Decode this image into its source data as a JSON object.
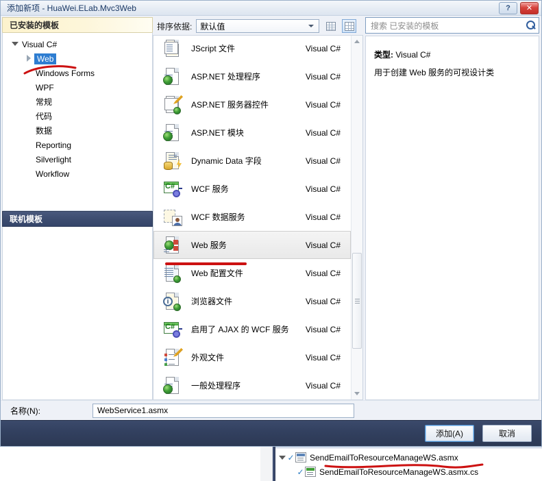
{
  "window": {
    "title": "添加新项 - HuaWei.ELab.Mvc3Web",
    "help_label": "?",
    "close_label": "✕"
  },
  "left": {
    "installed_header": "已安装的模板",
    "online_header": "联机模板",
    "tree": [
      {
        "label": "Visual C#",
        "level": 0,
        "twisty": "open",
        "selected": false
      },
      {
        "label": "Web",
        "level": 1,
        "twisty": "closed",
        "selected": true
      },
      {
        "label": "Windows Forms",
        "level": 1,
        "twisty": "none",
        "selected": false
      },
      {
        "label": "WPF",
        "level": 1,
        "twisty": "none",
        "selected": false
      },
      {
        "label": "常规",
        "level": 1,
        "twisty": "none",
        "selected": false
      },
      {
        "label": "代码",
        "level": 1,
        "twisty": "none",
        "selected": false
      },
      {
        "label": "数据",
        "level": 1,
        "twisty": "none",
        "selected": false
      },
      {
        "label": "Reporting",
        "level": 1,
        "twisty": "none",
        "selected": false
      },
      {
        "label": "Silverlight",
        "level": 1,
        "twisty": "none",
        "selected": false
      },
      {
        "label": "Workflow",
        "level": 1,
        "twisty": "none",
        "selected": false
      }
    ]
  },
  "toolbar": {
    "sort_label": "排序依据:",
    "sort_value": "默认值",
    "view_small_title": "小图标视图",
    "view_medium_title": "中等图标视图"
  },
  "search": {
    "placeholder": "搜索 已安装的模板"
  },
  "details": {
    "type_label": "类型:",
    "type_value": "Visual C#",
    "description": "用于创建 Web 服务的可视设计类"
  },
  "templates": [
    {
      "name": "JScript 文件",
      "lang": "Visual C#",
      "icon": "jscript-file-icon",
      "selected": false
    },
    {
      "name": "ASP.NET 处理程序",
      "lang": "Visual C#",
      "icon": "aspnet-handler-icon",
      "selected": false
    },
    {
      "name": "ASP.NET 服务器控件",
      "lang": "Visual C#",
      "icon": "aspnet-server-control-icon",
      "selected": false
    },
    {
      "name": "ASP.NET 模块",
      "lang": "Visual C#",
      "icon": "aspnet-module-icon",
      "selected": false
    },
    {
      "name": "Dynamic Data 字段",
      "lang": "Visual C#",
      "icon": "dynamic-data-field-icon",
      "selected": false
    },
    {
      "name": "WCF 服务",
      "lang": "Visual C#",
      "icon": "wcf-service-icon",
      "selected": false
    },
    {
      "name": "WCF 数据服务",
      "lang": "Visual C#",
      "icon": "wcf-data-service-icon",
      "selected": false
    },
    {
      "name": "Web 服务",
      "lang": "Visual C#",
      "icon": "web-service-icon",
      "selected": true
    },
    {
      "name": "Web 配置文件",
      "lang": "Visual C#",
      "icon": "web-config-icon",
      "selected": false
    },
    {
      "name": "浏览器文件",
      "lang": "Visual C#",
      "icon": "browser-file-icon",
      "selected": false
    },
    {
      "name": "启用了 AJAX 的 WCF 服务",
      "lang": "Visual C#",
      "icon": "ajax-wcf-service-icon",
      "selected": false
    },
    {
      "name": "外观文件",
      "lang": "Visual C#",
      "icon": "skin-file-icon",
      "selected": false
    },
    {
      "name": "一般处理程序",
      "lang": "Visual C#",
      "icon": "generic-handler-icon",
      "selected": false
    }
  ],
  "name_field": {
    "label": "名称(N):",
    "value": "WebService1.asmx"
  },
  "buttons": {
    "add": "添加(A)",
    "cancel": "取消"
  },
  "solution_explorer": {
    "items": [
      {
        "label": "SendEmailToResourceManageWS.asmx",
        "indent": false
      },
      {
        "label": "SendEmailToResourceManageWS.asmx.cs",
        "indent": true
      }
    ]
  },
  "colors": {
    "accent_selection": "#2e7dd1",
    "installed_header": "#fdf3cd",
    "online_header": "#3d4d70",
    "footer": "#32405f",
    "annotation_red": "#cc1111"
  }
}
